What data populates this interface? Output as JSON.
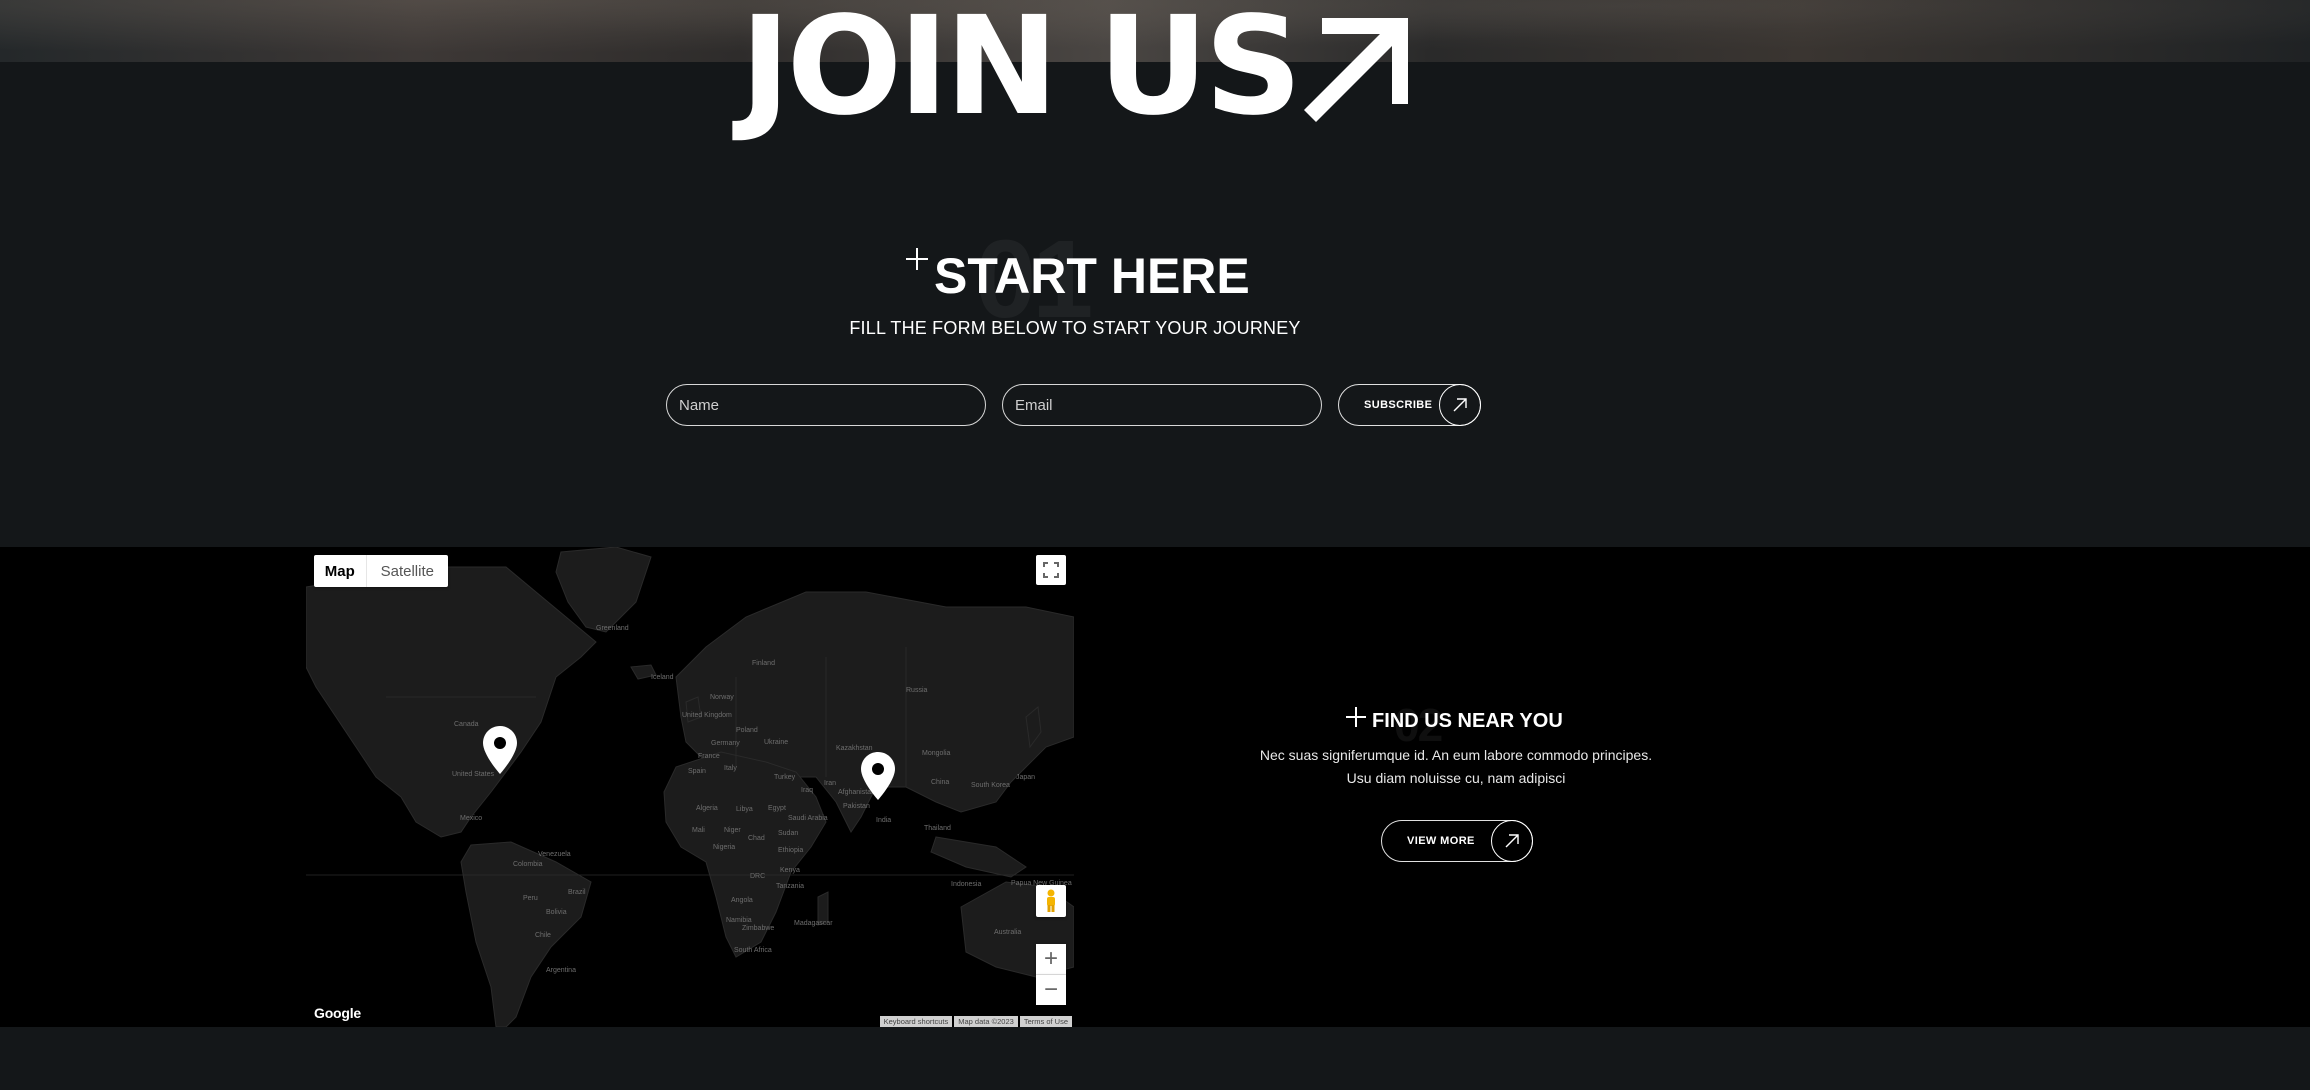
{
  "hero": {
    "title": "JOIN US",
    "arrow_icon": "arrow-up-right-icon"
  },
  "start": {
    "ghost_number": "01",
    "title": "START HERE",
    "subtitle": "FILL THE FORM BELOW TO START YOUR JOURNEY",
    "name_placeholder": "Name",
    "email_placeholder": "Email",
    "subscribe_label": "SUBSCRIBE"
  },
  "map": {
    "type_tabs": [
      "Map",
      "Satellite"
    ],
    "google_logo": "Google",
    "footer": [
      "Keyboard shortcuts",
      "Map data ©2023",
      "Terms of Use"
    ],
    "labels": {
      "greenland": "Greenland",
      "iceland": "Iceland",
      "finland": "Finland",
      "norway": "Norway",
      "russia": "Russia",
      "canada": "Canada",
      "united_kingdom": "United Kingdom",
      "poland": "Poland",
      "germany": "Germany",
      "ukraine": "Ukraine",
      "kazakhstan": "Kazakhstan",
      "mongolia": "Mongolia",
      "france": "France",
      "united_states": "United States",
      "spain": "Spain",
      "italy": "Italy",
      "turkey": "Turkey",
      "china": "China",
      "japan": "Japan",
      "south_korea": "South Korea",
      "iran": "Iran",
      "iraq": "Iraq",
      "afghanistan": "Afghanistan",
      "pakistan": "Pakistan",
      "algeria": "Algeria",
      "libya": "Libya",
      "egypt": "Egypt",
      "saudi_arabia": "Saudi Arabia",
      "india": "India",
      "mexico": "Mexico",
      "thailand": "Thailand",
      "mali": "Mali",
      "niger": "Niger",
      "chad": "Chad",
      "sudan": "Sudan",
      "nigeria": "Nigeria",
      "ethiopia": "Ethiopia",
      "venezuela": "Venezuela",
      "colombia": "Colombia",
      "drc": "DRC",
      "kenya": "Kenya",
      "tanzania": "Tanzania",
      "indonesia": "Indonesia",
      "peru": "Peru",
      "brazil": "Brazil",
      "angola": "Angola",
      "bolivia": "Bolivia",
      "namibia": "Namibia",
      "madagascar": "Madagascar",
      "zimbabwe": "Zimbabwe",
      "chile": "Chile",
      "australia": "Australia",
      "south_africa": "South Africa",
      "argentina": "Argentina",
      "papua_new_guinea": "Papua New Guinea"
    }
  },
  "find": {
    "ghost_number": "02",
    "title": "FIND US NEAR YOU",
    "description": "Nec suas signiferumque id. An eum labore commodo principes. Usu diam noluisse cu, nam adipisci",
    "button_label": "VIEW MORE"
  }
}
